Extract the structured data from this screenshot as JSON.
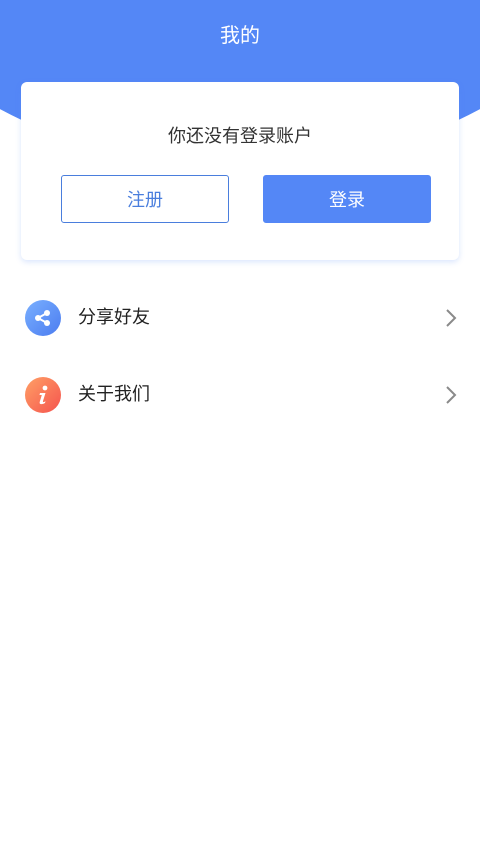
{
  "header": {
    "title": "我的"
  },
  "account": {
    "message": "你还没有登录账户",
    "register_label": "注册",
    "login_label": "登录"
  },
  "menu": {
    "items": [
      {
        "label": "分享好友",
        "icon": "share-icon"
      },
      {
        "label": "关于我们",
        "icon": "info-icon"
      }
    ]
  },
  "colors": {
    "brand": "#5487f6",
    "register_border": "#4a7edd",
    "share_icon": "#5b8ff5",
    "info_icon": "#f7704f"
  }
}
